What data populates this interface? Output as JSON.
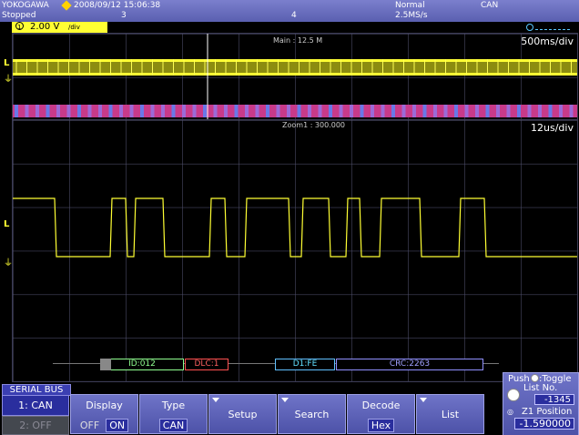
{
  "header": {
    "brand": "YOKOGAWA",
    "datetime": "2008/09/12 15:06:38",
    "status": "Stopped",
    "count": "3",
    "center_value": "4",
    "trigger_mode": "Normal",
    "sample_rate": "2.5MS/s",
    "trigger_type": "CAN"
  },
  "channel": {
    "label": "1",
    "scale": "2.00 V",
    "unit_suffix": "/div",
    "color": "#ffff33"
  },
  "main_plot": {
    "title": "Main : 12.5 M",
    "timebase": "500ms/div",
    "level_marker": "L",
    "ground_marker": "⏚"
  },
  "zoom_plot": {
    "title": "Zoom1 : 300.000",
    "timebase": "12us/div",
    "level_marker": "L",
    "ground_marker": "⏚"
  },
  "decode": {
    "segments": [
      "ID:012",
      "DLC:1",
      "D1:FE",
      "CRC:2263"
    ]
  },
  "serial_bus": {
    "title": "SERIAL BUS",
    "bus1": "1: CAN",
    "bus2": "2: OFF"
  },
  "softkeys": {
    "display": {
      "label": "Display",
      "off": "OFF",
      "on": "ON"
    },
    "type": {
      "label": "Type",
      "value": "CAN"
    },
    "setup": {
      "label": "Setup"
    },
    "search": {
      "label": "Search"
    },
    "decode": {
      "label": "Decode",
      "value": "Hex"
    },
    "list": {
      "label": "List"
    }
  },
  "knob_panel": {
    "push_label": "Push",
    "toggle_label": ":Toggle",
    "list_no_label": "List No.",
    "list_no_value": "-1345",
    "z1_label": "Z1 Position",
    "z1_value": "-1.590000"
  },
  "icons": [
    "logo-diamond-icon",
    "channel-circle-icon",
    "trigger-icon",
    "dial-icon",
    "arrow-down-icon"
  ]
}
